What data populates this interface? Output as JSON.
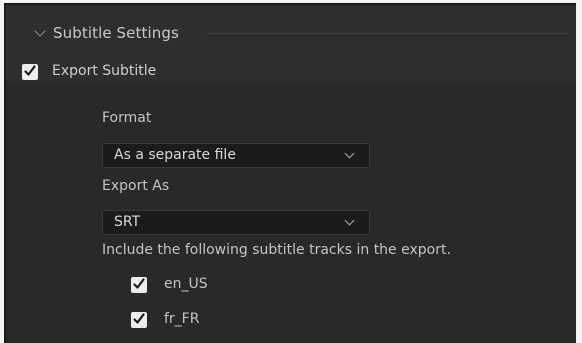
{
  "section": {
    "title": "Subtitle Settings"
  },
  "export_subtitle": {
    "label": "Export Subtitle",
    "checked": true
  },
  "format": {
    "label": "Format",
    "selected": "As a separate file"
  },
  "export_as": {
    "label": "Export As",
    "selected": "SRT"
  },
  "tracks": {
    "description": "Include the following subtitle tracks in the export.",
    "items": [
      {
        "label": "en_US",
        "checked": true
      },
      {
        "label": "fr_FR",
        "checked": true
      }
    ]
  },
  "colors": {
    "panel_bg": "#29292b",
    "header_bg": "#2e2e30",
    "dropdown_bg": "#1b1b1c",
    "text": "#c4c4c6",
    "checkbox_bg": "#ededed",
    "check_mark": "#1a1a1a"
  }
}
